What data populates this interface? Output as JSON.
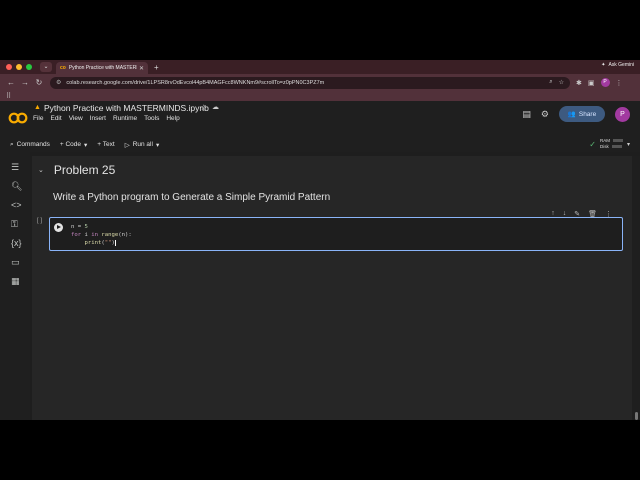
{
  "browser": {
    "tab_title": "Python Practice with MASTERMINDS",
    "url": "colab.research.google.com/drive/1LPSR8rvOdEvcol44pB4MAGFcc8WNKNm9#scrollTo=z0pPN0C3PZ7m",
    "ask_gemini": "Ask Gemini",
    "profile_initial": "P",
    "light_colors": [
      "#ff5f57",
      "#febc2e",
      "#28c840"
    ]
  },
  "colab": {
    "notebook_title": "Python Practice with MASTERMINDS.ipynb",
    "menus": [
      "File",
      "Edit",
      "View",
      "Insert",
      "Runtime",
      "Tools",
      "Help"
    ],
    "share_label": "Share",
    "avatar_initial": "P",
    "toolbar": {
      "commands": "Commands",
      "code": "+ Code",
      "text": "+ Text",
      "run_all": "Run all"
    },
    "resources": {
      "ram": "RAM",
      "disk": "Disk"
    }
  },
  "notebook": {
    "section_title": "Problem 25",
    "description": "Write a Python program to Generate a Simple Pyramid Pattern",
    "code_lines": [
      "n = 5",
      "for i in range(n):",
      "    print(\"\")"
    ]
  }
}
